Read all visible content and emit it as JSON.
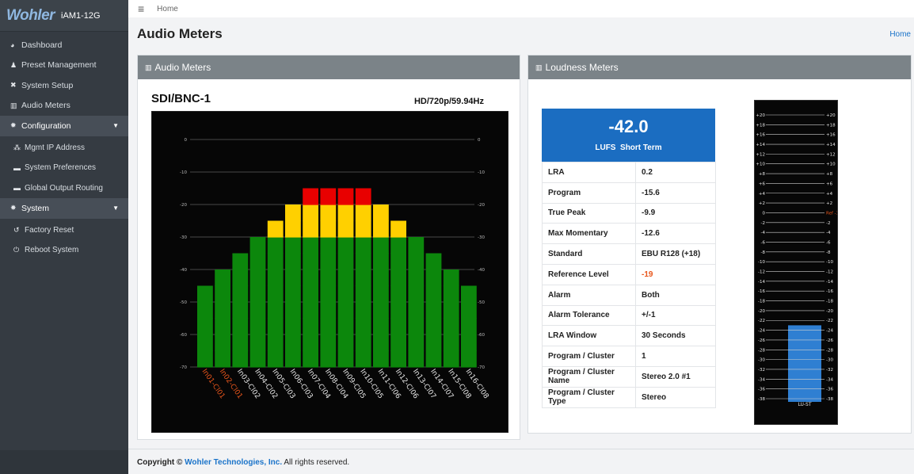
{
  "brand": {
    "logo": "Wohler",
    "model": "iAM1-12G"
  },
  "sidebar": {
    "items": [
      {
        "label": "Dashboard",
        "icon": "dashboard-icon",
        "glyph": "◕"
      },
      {
        "label": "Preset Management",
        "icon": "users-icon",
        "glyph": "♟"
      },
      {
        "label": "System Setup",
        "icon": "tools-icon",
        "glyph": "✖"
      },
      {
        "label": "Audio Meters",
        "icon": "chart-icon",
        "glyph": "▥"
      }
    ],
    "config": {
      "label": "Configuration",
      "glyph": "✹"
    },
    "config_items": [
      {
        "label": "Mgmt IP Address",
        "glyph": "⁂"
      },
      {
        "label": "System Preferences",
        "glyph": "▬"
      },
      {
        "label": "Global Output Routing",
        "glyph": "▬"
      }
    ],
    "system": {
      "label": "System",
      "glyph": "✸"
    },
    "system_items": [
      {
        "label": "Factory Reset",
        "glyph": "↺"
      },
      {
        "label": "Reboot System",
        "glyph": "⏻"
      }
    ]
  },
  "topbar": {
    "menu_glyph": "≡",
    "home": "Home"
  },
  "page": {
    "title": "Audio Meters",
    "breadcrumb": "Home"
  },
  "audio_card": {
    "header": "Audio Meters",
    "icon_glyph": "▥",
    "source": "SDI/BNC-1",
    "format": "HD/720p/59.94Hz",
    "scale": [
      "0",
      "-10",
      "-20",
      "-30",
      "-40",
      "-50",
      "-60",
      "-70"
    ]
  },
  "chart_data": {
    "type": "bar",
    "categories": [
      "In01-Cl01",
      "In02-Cl01",
      "In03-Cl02",
      "In04-Cl02",
      "In05-Cl03",
      "In06-Cl03",
      "In07-Cl04",
      "In08-Cl04",
      "In09-Cl05",
      "In10-Cl05",
      "In11-Cl06",
      "In12-Cl06",
      "In13-Cl07",
      "In14-Cl07",
      "In15-Cl08",
      "In16-Cl08"
    ],
    "values": [
      -45,
      -40,
      -35,
      -30,
      -25,
      -20,
      -15,
      -15,
      -15,
      -15,
      -20,
      -25,
      -30,
      -35,
      -40,
      -45
    ],
    "highlight_labels": [
      "In01-Cl01",
      "In02-Cl01"
    ],
    "ylim": [
      -70,
      0
    ],
    "zones": {
      "green_max": -30,
      "yellow_max": -20
    },
    "colors": {
      "green": "#0c870c",
      "yellow": "#ffd000",
      "red": "#e80000",
      "highlight": "#e8561c"
    },
    "grid": true
  },
  "loudness_card": {
    "header": "Loudness Meters",
    "icon_glyph": "▥",
    "value": "-42.0",
    "unit": "LUFS",
    "mode": "Short Term",
    "stats": [
      {
        "key": "LRA",
        "value": "0.2"
      },
      {
        "key": "Program",
        "value": "-15.6"
      },
      {
        "key": "True Peak",
        "value": "-9.9"
      },
      {
        "key": "Max Momentary",
        "value": "-12.6"
      },
      {
        "key": "Standard",
        "value": "EBU R128 (+18)"
      },
      {
        "key": "Reference Level",
        "value": "-19",
        "color": "#e8561c"
      },
      {
        "key": "Alarm",
        "value": "Both"
      },
      {
        "key": "Alarm Tolerance",
        "value": "+/-1"
      },
      {
        "key": "LRA Window",
        "value": "30 Seconds"
      },
      {
        "key": "Program / Cluster",
        "value": "1"
      },
      {
        "key": "Program / Cluster Name",
        "value": "Stereo 2.0 #1"
      },
      {
        "key": "Program / Cluster Type",
        "value": "Stereo"
      }
    ]
  },
  "lu_meter": {
    "label": "LU-ST",
    "ref_label": "Ref -19",
    "ticks": [
      "+20",
      "+18",
      "+16",
      "+14",
      "+12",
      "+10",
      "+8",
      "+6",
      "+4",
      "+2",
      "0",
      "-2",
      "-4",
      "-6",
      "-8",
      "-10",
      "-12",
      "-14",
      "-16",
      "-18",
      "-20",
      "-22",
      "-24",
      "-26",
      "-28",
      "-30",
      "-32",
      "-34",
      "-36",
      "-38"
    ],
    "level": -23,
    "range": [
      -38,
      20
    ],
    "colors": {
      "bar": "#2f7fd2",
      "ref": "#e8561c"
    }
  },
  "footer": {
    "prefix": "Copyright ©",
    "company": "Wohler Technologies, Inc.",
    "suffix": "All rights reserved."
  }
}
